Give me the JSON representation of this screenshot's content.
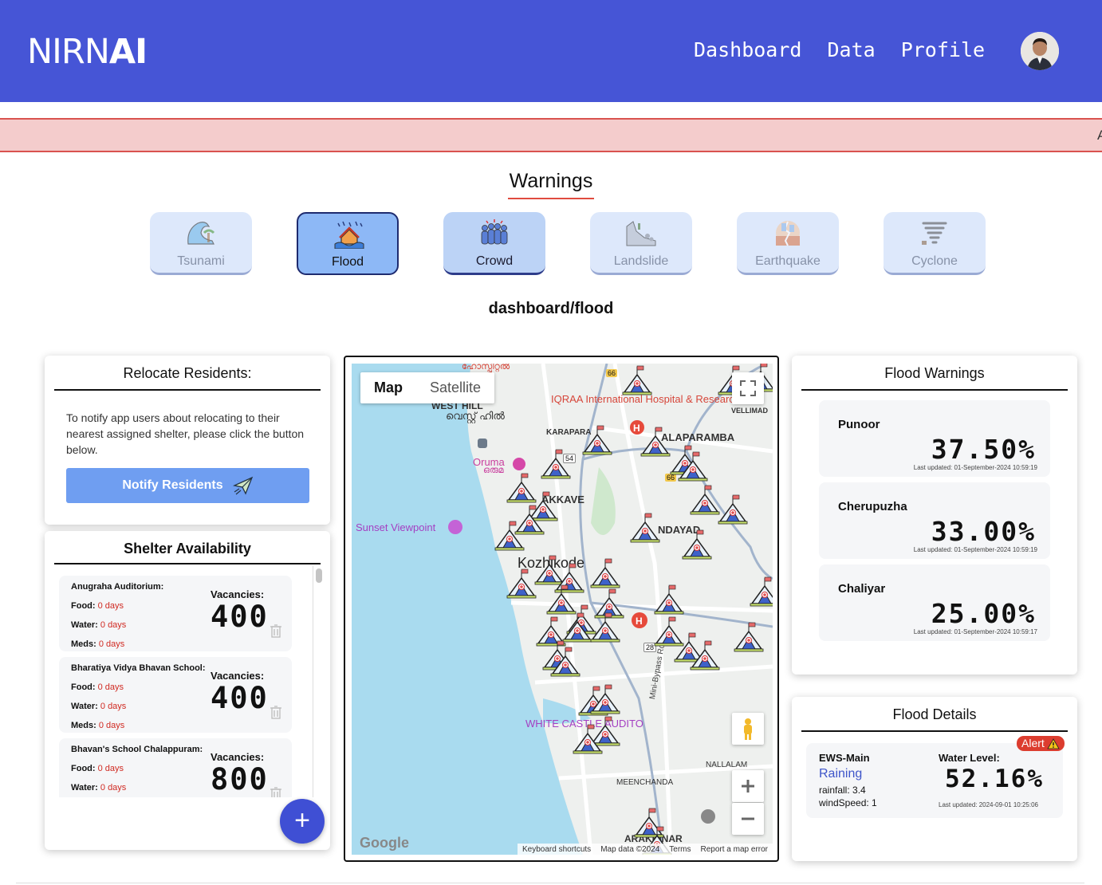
{
  "app": {
    "logo_light": "NIRN",
    "logo_bold": "AI"
  },
  "nav": {
    "dashboard": "Dashboard",
    "data": "Data",
    "profile": "Profile"
  },
  "ticker": {
    "text": "A"
  },
  "warnings": {
    "title": "Warnings",
    "hazards": [
      "Tsunami",
      "Flood",
      "Crowd",
      "Landslide",
      "Earthquake",
      "Cyclone"
    ],
    "active": "Flood"
  },
  "breadcrumb": "dashboard/flood",
  "relocate": {
    "title": "Relocate Residents:",
    "text": "To notify app users about relocating to their nearest assigned shelter, please click the button below.",
    "button": "Notify Residents"
  },
  "shelter": {
    "title": "Shelter Availability",
    "vacancies_label": "Vacancies:",
    "food_label": "Food:",
    "water_label": "Water:",
    "meds_label": "Meds:",
    "items": [
      {
        "name": "Anugraha Auditorium:",
        "food": "0 days",
        "water": "0 days",
        "meds": "0 days",
        "vacancies": "400"
      },
      {
        "name": "Bharatiya Vidya Bhavan School:",
        "food": "0 days",
        "water": "0 days",
        "meds": "0 days",
        "vacancies": "400"
      },
      {
        "name": "Bhavan's School Chalappuram:",
        "food": "0 days",
        "water": "0 days",
        "vacancies": "800"
      }
    ],
    "add": "+"
  },
  "map": {
    "tab_map": "Map",
    "tab_satellite": "Satellite",
    "labels": {
      "iqraa": "IQRAA International Hospital & Research...",
      "westhill": "WEST HILL",
      "westhill_ml": "വെസ്റ്റ് ഹിൽ",
      "oruma": "Oruma",
      "oruma_ml": "ഒരുമ",
      "sunset": "Sunset Viewpoint",
      "kozhikode": "Kozhikode",
      "akkave": "AKKAVE",
      "alaparamba": "ALAPARAMBA",
      "ndayad": "NDAYAD",
      "karapara": "KARAPARA",
      "hospital_ml": "ഹോസ്പിറ്റൽ",
      "vellimad": "VELLIMAD",
      "white_castle": "WHITE CASTLE AUDITO",
      "bypass": "Mini-Bypass Rd",
      "meenchanda": "MEENCHANDA",
      "nallalam": "NALLALAM",
      "arakkinar": "ARAKKINAR",
      "road66": "66",
      "road54": "54",
      "road28": "28",
      "road66b": "66"
    },
    "footer": {
      "shortcuts": "Keyboard shortcuts",
      "mapdata": "Map data ©2024",
      "terms": "Terms",
      "report": "Report a map error"
    },
    "google": "Google"
  },
  "flood_warnings": {
    "title": "Flood Warnings",
    "items": [
      {
        "name": "Punoor",
        "value": "37.50%",
        "updated": "Last updated: 01-September-2024 10:59:19"
      },
      {
        "name": "Cherupuzha",
        "value": "33.00%",
        "updated": "Last updated: 01-September-2024 10:59:19"
      },
      {
        "name": "Chaliyar",
        "value": "25.00%",
        "updated": "Last updated: 01-September-2024 10:59:17"
      }
    ]
  },
  "flood_details": {
    "title": "Flood Details",
    "station": "EWS-Main",
    "status": "Raining",
    "rainfall": "rainfall: 3.4",
    "windspeed": "windSpeed: 1",
    "water_label": "Water Level:",
    "water_value": "52.16%",
    "updated": "Last updated: 2024-09-01 10:25:06",
    "alert": "Alert"
  },
  "colors": {
    "header": "#4655d6",
    "accent_red": "#dc3d2f",
    "button": "#6f9ef1"
  }
}
